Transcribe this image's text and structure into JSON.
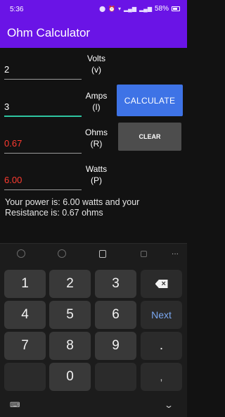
{
  "status_bar": {
    "time": "5:36",
    "battery": "58%",
    "icons": [
      "notification-icon",
      "alarm-icon",
      "wifi-icon",
      "signal-icon",
      "signal-icon",
      "battery-icon"
    ]
  },
  "app": {
    "title": "Ohm Calculator"
  },
  "fields": [
    {
      "value": "2",
      "label_line1": "Volts",
      "label_line2": "(v)"
    },
    {
      "value": "3",
      "label_line1": "Amps",
      "label_line2": "(I)"
    },
    {
      "value": "0.67",
      "label_line1": "Ohms",
      "label_line2": "(R)"
    },
    {
      "value": "6.00",
      "label_line1": "Watts",
      "label_line2": "(P)"
    }
  ],
  "buttons": {
    "calculate": "CALCULATE",
    "clear": "CLEAR"
  },
  "result": {
    "text": "Your power is: 6.00 watts and your Resistance is: 0.67 ohms"
  },
  "colors": {
    "accent": "#6a14e6",
    "button_primary": "#3e73e6",
    "result_red": "#ff3b30",
    "focus_teal": "#2ec5a0"
  },
  "keyboard": {
    "toolbar_icons": [
      "emoji-icon",
      "sticker-icon",
      "clipboard-icon",
      "copy-icon",
      "more-icon"
    ],
    "more_label": "···",
    "keys": {
      "k1": "1",
      "k2": "2",
      "k3": "3",
      "k4": "4",
      "k5": "5",
      "k6": "6",
      "k7": "7",
      "k8": "8",
      "k9": "9",
      "k0": "0",
      "next": "Next",
      "dot": ".",
      "comma": ","
    }
  },
  "nav": {
    "keyboard_glyph": "⌨",
    "chevron_glyph": "⌄"
  }
}
